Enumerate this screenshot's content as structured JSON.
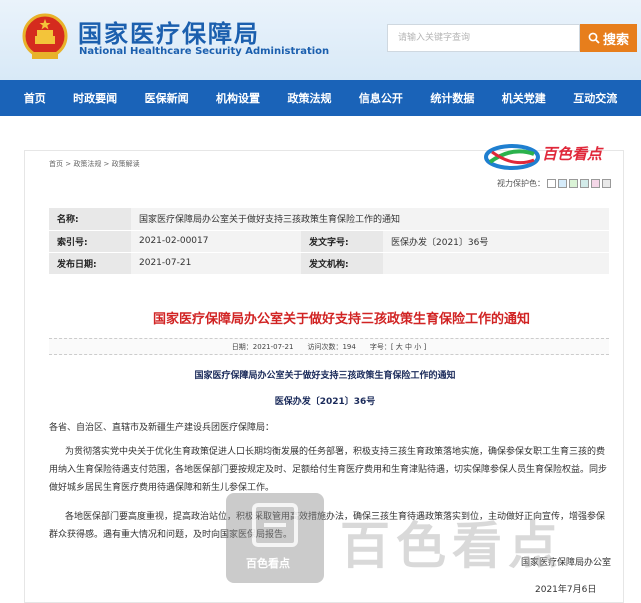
{
  "header": {
    "title_cn": "国家医疗保障局",
    "title_en": "National Healthcare Security Administration",
    "search_placeholder": "请输入关键字查询",
    "search_button": "搜索"
  },
  "nav": [
    "首页",
    "时政要闻",
    "医保新闻",
    "机构设置",
    "政策法规",
    "信息公开",
    "统计数据",
    "机关党建",
    "互动交流"
  ],
  "breadcrumb": "首页 > 政策法规 > 政策解读",
  "color_protect_label": "视力保护色：",
  "swatch_colors": [
    "#ffffff",
    "#d6ecfb",
    "#daf3d6",
    "#d2ebe9",
    "#f5d7e8",
    "#e9e9e9"
  ],
  "info": {
    "name_label": "名称:",
    "name_value": "国家医疗保障局办公室关于做好支持三孩政策生育保险工作的通知",
    "index_label": "索引号:",
    "index_value": "2021-02-00017",
    "docno_label": "发文字号:",
    "docno_value": "医保办发〔2021〕36号",
    "date_label": "发布日期:",
    "date_value": "2021-07-21",
    "org_label": "发文机构:",
    "org_value": ""
  },
  "big_title": "国家医疗保障局办公室关于做好支持三孩政策生育保险工作的通知",
  "watermark_text": "百色看点",
  "meta": {
    "date": "日期：2021-07-21",
    "visits": "访问次数：194",
    "font": "字号：[ 大 中 小 ]"
  },
  "doc": {
    "title": "国家医疗保障局办公室关于做好支持三孩政策生育保险工作的通知",
    "number": "医保办发〔2021〕36号",
    "greeting": "各省、自治区、直辖市及新疆生产建设兵团医疗保障局：",
    "p1_l1": "为贯彻落实党中央关于优化生育政策促进人口长期均衡发展的任务部署，积极支持三孩生育政策落地实施，确保参保女职工生育三孩的费",
    "p1_l2": "用纳入生育保险待遇支付范围，各地医保部门要按规定及时、足额给付生育医疗费用和生育津贴待遇，切实保障参保人员生育保险权益。同步",
    "p1_l3": "做好城乡居民生育医疗费用待遇保障和新生儿参保工作。",
    "p2_l1": "各地医保部门要高度重视，提高政治站位，积极采取管用高效措施办法，确保三孩生育待遇政策落实到位，主动做好正向宣传，增强参保",
    "p2_l2": "群众获得感。遇有重大情况和问题，及时向国家医保局报告。",
    "signature": "国家医疗保障局办公室",
    "sign_date": "2021年7月6日"
  },
  "watermark_box_text": "百色看点",
  "watermark_big": "百色看点"
}
